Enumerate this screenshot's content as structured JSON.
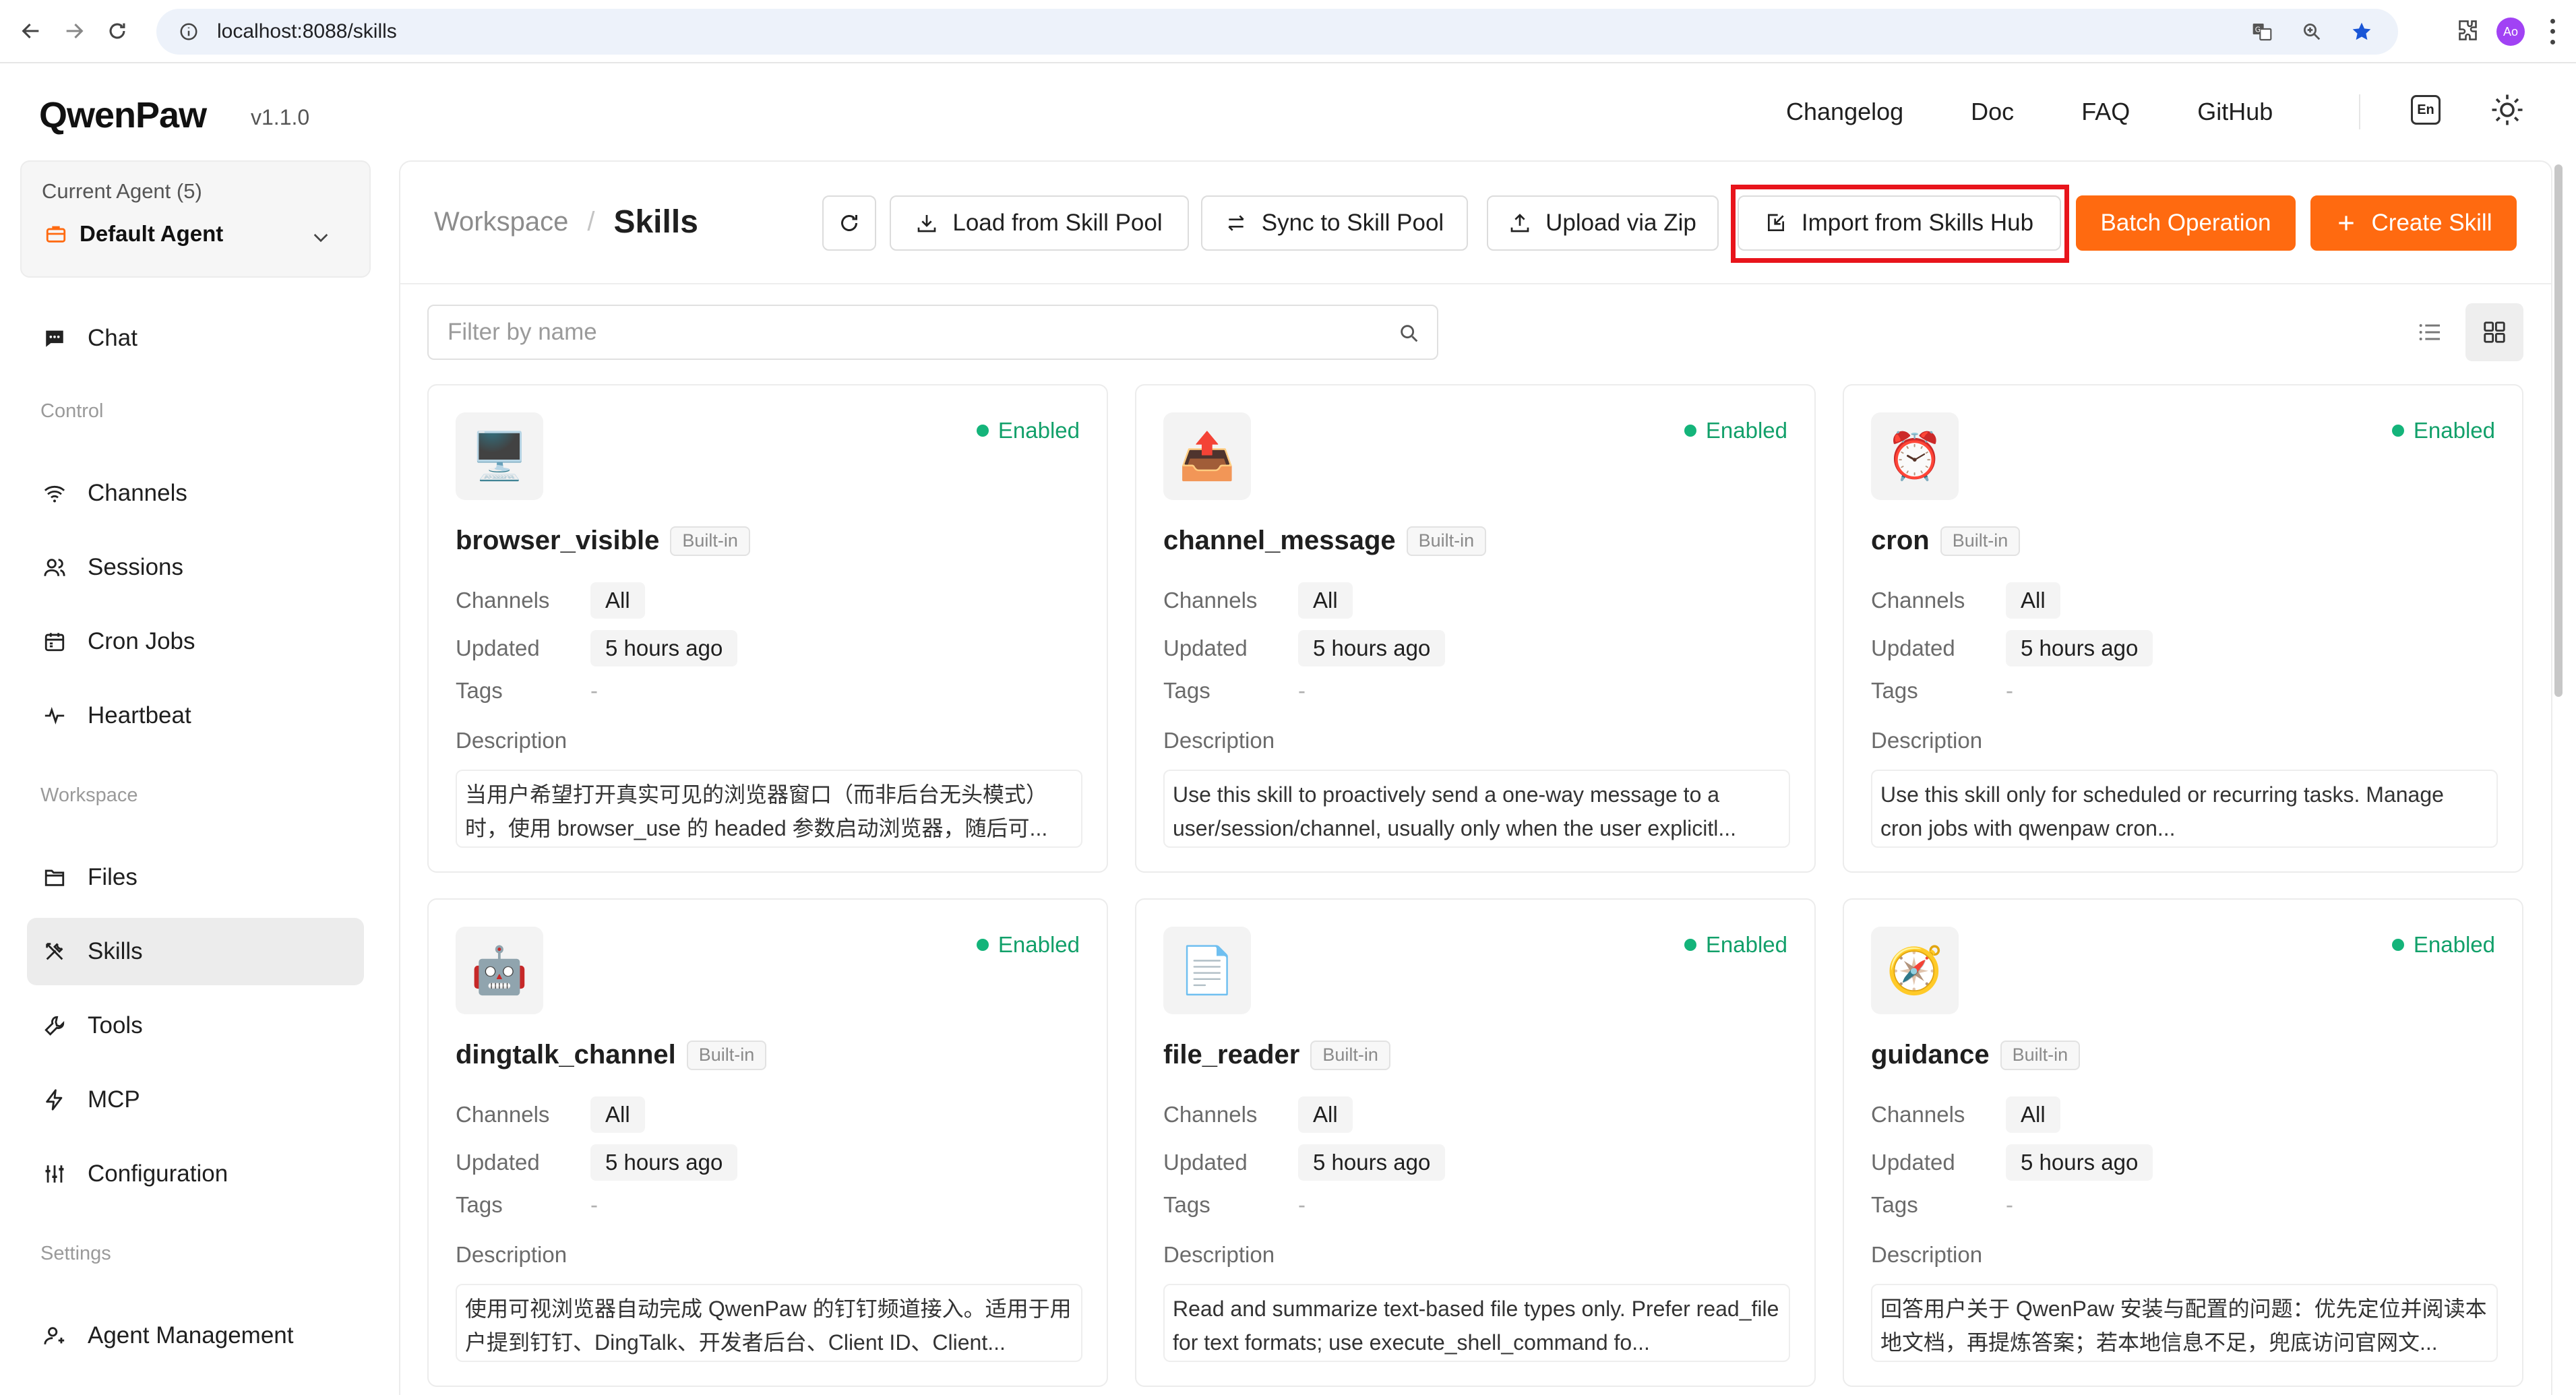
{
  "browser": {
    "url": "localhost:8088/skills",
    "profile_initials": "Ao"
  },
  "header": {
    "logo": "QwenPaw",
    "version": "v1.1.0",
    "nav": [
      "Changelog",
      "Doc",
      "FAQ",
      "GitHub"
    ],
    "lang": "En"
  },
  "sidebar": {
    "agent_label": "Current Agent (5)",
    "agent_name": "Default Agent",
    "chat": "Chat",
    "group_control": "Control",
    "control_items": [
      "Channels",
      "Sessions",
      "Cron Jobs",
      "Heartbeat"
    ],
    "group_workspace": "Workspace",
    "workspace_items": [
      "Files",
      "Skills",
      "Tools",
      "MCP",
      "Configuration"
    ],
    "group_settings": "Settings",
    "settings_items": [
      "Agent Management"
    ],
    "active_item": "Skills"
  },
  "toolbar": {
    "breadcrumb_parent": "Workspace",
    "breadcrumb_sep": "/",
    "breadcrumb_current": "Skills",
    "load_pool": "Load from Skill Pool",
    "sync_pool": "Sync to Skill Pool",
    "upload_zip": "Upload via Zip",
    "import_hub": "Import from Skills Hub",
    "batch": "Batch Operation",
    "create": "Create Skill",
    "accent_color": "#ff6a10",
    "highlight_color": "#e8141b"
  },
  "filter": {
    "placeholder": "Filter by name",
    "value": ""
  },
  "labels": {
    "channels": "Channels",
    "updated": "Updated",
    "tags": "Tags",
    "description": "Description",
    "builtin": "Built-in",
    "enabled": "Enabled",
    "empty": "-"
  },
  "skills": [
    {
      "name": "browser_visible",
      "icon": "🖥️",
      "icon_name": "monitor-icon",
      "channels": "All",
      "updated": "5 hours ago",
      "description": "当用户希望打开真实可见的浏览器窗口（而非后台无头模式）时，使用 browser_use 的 headed 参数启动浏览器，随后可..."
    },
    {
      "name": "channel_message",
      "icon": "📤",
      "icon_name": "outbox-tray-icon",
      "channels": "All",
      "updated": "5 hours ago",
      "description": "Use this skill to proactively send a one-way message to a user/session/channel, usually only when the user explicitl..."
    },
    {
      "name": "cron",
      "icon": "⏰",
      "icon_name": "alarm-clock-icon",
      "channels": "All",
      "updated": "5 hours ago",
      "description": "Use this skill only for scheduled or recurring tasks. Manage cron jobs with qwenpaw cron..."
    },
    {
      "name": "dingtalk_channel",
      "icon": "🤖",
      "icon_name": "robot-icon",
      "channels": "All",
      "updated": "5 hours ago",
      "description": "使用可视浏览器自动完成 QwenPaw 的钉钉频道接入。适用于用户提到钉钉、DingTalk、开发者后台、Client ID、Client..."
    },
    {
      "name": "file_reader",
      "icon": "📄",
      "icon_name": "document-icon",
      "channels": "All",
      "updated": "5 hours ago",
      "description": "Read and summarize text-based file types only. Prefer read_file for text formats; use execute_shell_command fo..."
    },
    {
      "name": "guidance",
      "icon": "🧭",
      "icon_name": "compass-icon",
      "channels": "All",
      "updated": "5 hours ago",
      "description": "回答用户关于 QwenPaw 安装与配置的问题：优先定位并阅读本地文档，再提炼答案；若本地信息不足，兜底访问官网文..."
    }
  ]
}
